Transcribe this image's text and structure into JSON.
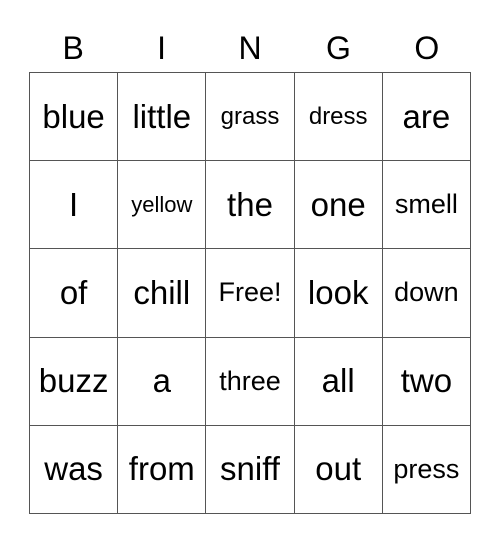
{
  "header": [
    "B",
    "I",
    "N",
    "G",
    "O"
  ],
  "cells": [
    [
      "blue",
      "little",
      "grass",
      "dress",
      "are"
    ],
    [
      "I",
      "yellow",
      "the",
      "one",
      "smell"
    ],
    [
      "of",
      "chill",
      "Free!",
      "look",
      "down"
    ],
    [
      "buzz",
      "a",
      "three",
      "all",
      "two"
    ],
    [
      "was",
      "from",
      "sniff",
      "out",
      "press"
    ]
  ]
}
